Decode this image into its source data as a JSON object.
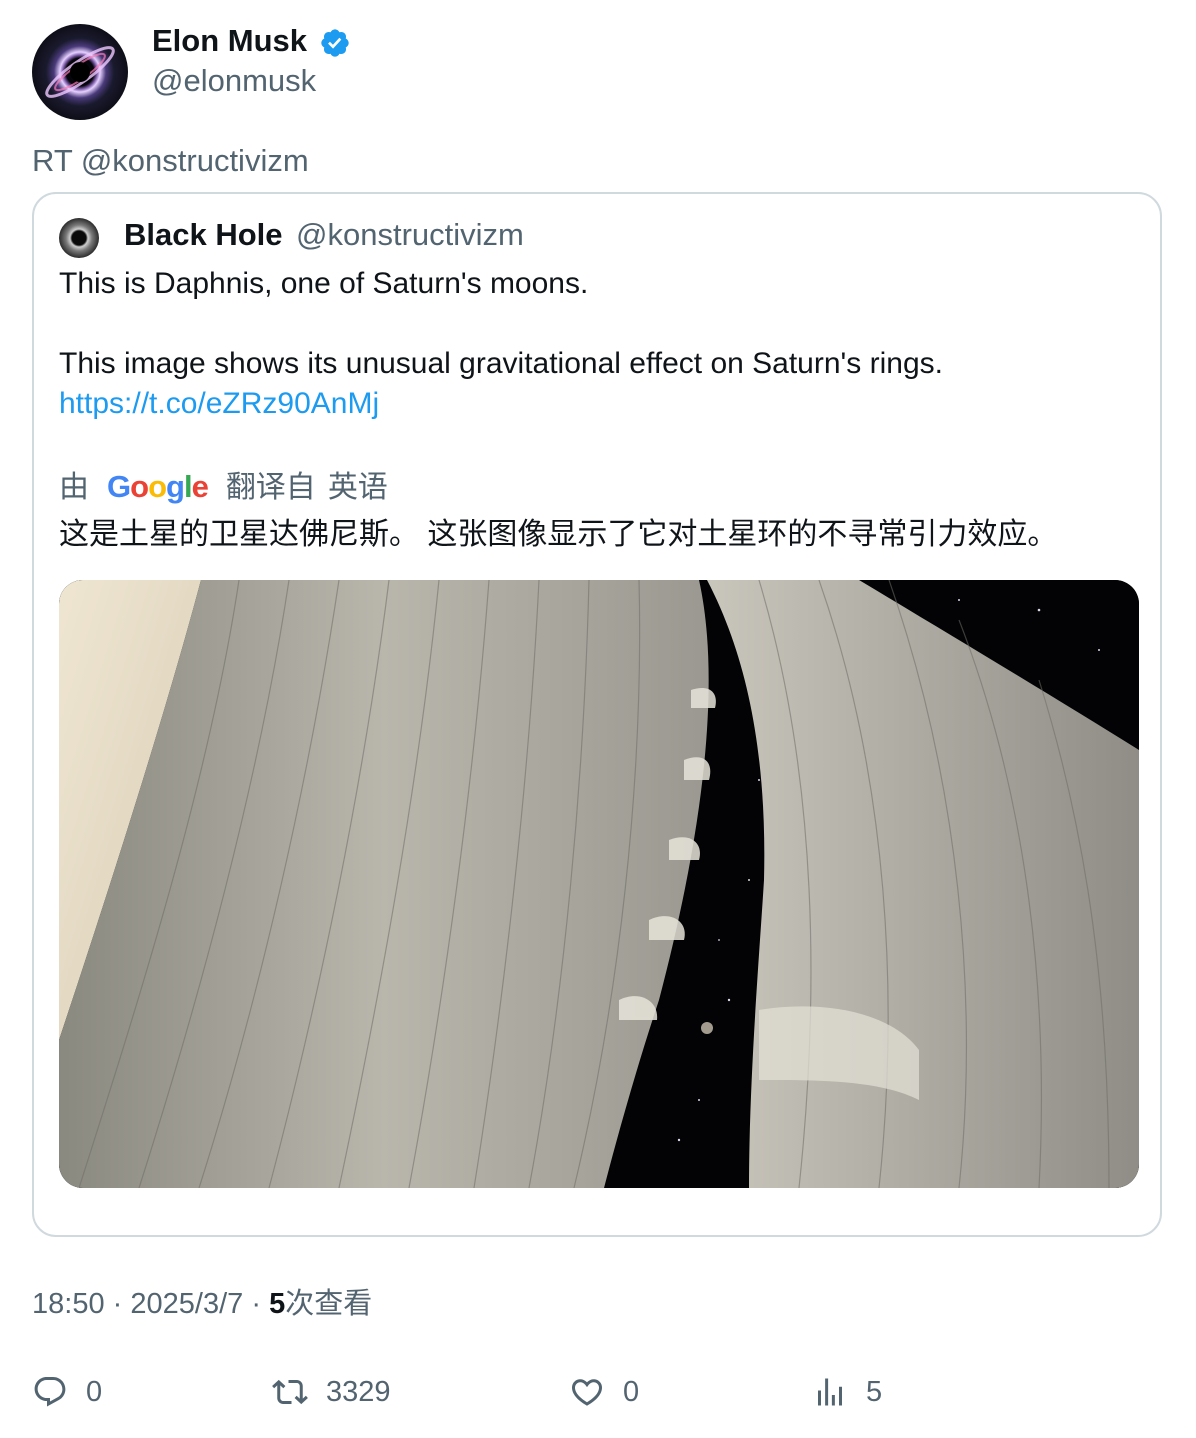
{
  "tweet": {
    "author": {
      "name": "Elon Musk",
      "handle": "@elonmusk",
      "verified": true
    },
    "retweet_text": "RT @konstructivizm",
    "quoted": {
      "author": {
        "name": "Black Hole",
        "handle": "@konstructivizm"
      },
      "text_line1": "This is Daphnis, one of Saturn's moons.",
      "text_line2": "This image shows its unusual gravitational effect on Saturn's rings.",
      "link": "https://t.co/eZRz90AnMj",
      "translation": {
        "by_label": "由",
        "provider": "Google",
        "source_label": "翻译自",
        "source_language": "英语",
        "text": "这是土星的卫星达佛尼斯。 这张图像显示了它对土星环的不寻常引力效应。"
      }
    },
    "meta": {
      "time": "18:50",
      "sep1": "·",
      "date": "2025/3/7",
      "sep2": "·",
      "views_count": "5",
      "views_label": "次查看"
    },
    "actions": {
      "replies": "0",
      "retweets": "3329",
      "likes": "0",
      "views": "5"
    }
  },
  "colors": {
    "accent": "#1d9bf0",
    "secondary_text": "#536471",
    "border": "#cfd9de"
  }
}
